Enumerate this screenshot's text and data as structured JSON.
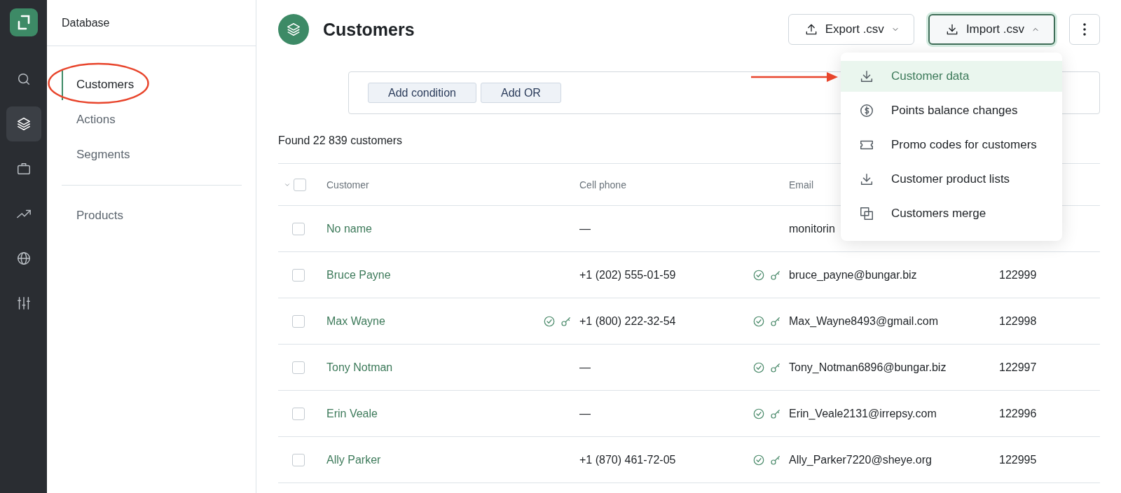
{
  "rail": {
    "items": [
      {
        "selected": false
      },
      {
        "selected": true
      },
      {
        "selected": false
      },
      {
        "selected": false
      },
      {
        "selected": false
      },
      {
        "selected": false
      }
    ]
  },
  "sidebar": {
    "title": "Database",
    "items": [
      {
        "label": "Customers",
        "selected": true
      },
      {
        "label": "Actions",
        "selected": false
      },
      {
        "label": "Segments",
        "selected": false
      }
    ],
    "secondary_items": [
      {
        "label": "Products",
        "selected": false
      }
    ]
  },
  "header": {
    "title": "Customers",
    "buttons": [
      {
        "label": "Export .csv",
        "expanded": false
      },
      {
        "label": "Import .csv",
        "expanded": true
      }
    ]
  },
  "import_menu": [
    {
      "label": "Customer data",
      "selected": true
    },
    {
      "label": "Points balance changes",
      "selected": false
    },
    {
      "label": "Promo codes for customers",
      "selected": false
    },
    {
      "label": "Customer product lists",
      "selected": false
    },
    {
      "label": "Customers merge",
      "selected": false
    }
  ],
  "filter": {
    "buttons": [
      "Add condition",
      "Add OR"
    ]
  },
  "found": "Found 22 839 customers",
  "table": {
    "header_checked": false,
    "columns": [
      "Customer",
      "Cell phone",
      "Email"
    ],
    "rows": [
      {
        "checked": false,
        "name": "No name",
        "phone": "—",
        "phone_confirmed": false,
        "email": "monitorin",
        "email_confirmed": false
      },
      {
        "checked": false,
        "name": "Bruce Payne",
        "phone": "+1 (202) 555-01-59",
        "phone_confirmed": false,
        "email": "bruce_payne@bungar.biz",
        "email_confirmed": true,
        "id": "122999"
      },
      {
        "checked": false,
        "name": "Max Wayne",
        "phone": "+1 (800) 222-32-54",
        "phone_confirmed": true,
        "email": "Max_Wayne8493@gmail.com",
        "email_confirmed": true,
        "id": "122998"
      },
      {
        "checked": false,
        "name": "Tony Notman",
        "phone": "—",
        "phone_confirmed": false,
        "email": "Tony_Notman6896@bungar.biz",
        "email_confirmed": true,
        "id": "122997"
      },
      {
        "checked": false,
        "name": "Erin Veale",
        "phone": "—",
        "phone_confirmed": false,
        "email": "Erin_Veale2131@irrepsy.com",
        "email_confirmed": true,
        "id": "122996"
      },
      {
        "checked": false,
        "name": "Ally Parker",
        "phone": "+1 (870) 461-72-05",
        "phone_confirmed": false,
        "email": "Ally_Parker7220@sheye.org",
        "email_confirmed": true,
        "id": "122995"
      }
    ]
  }
}
